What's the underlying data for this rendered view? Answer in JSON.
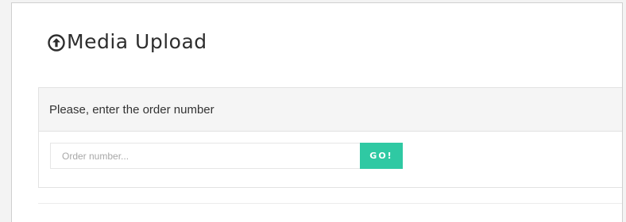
{
  "page": {
    "title": "Media Upload",
    "title_icon": "upload-circle-icon"
  },
  "order_panel": {
    "heading": "Please, enter the order number",
    "input_placeholder": "Order number...",
    "input_value": "",
    "submit_label": "GO!"
  },
  "colors": {
    "accent": "#2fc9a3",
    "panel_header_bg": "#f5f5f5",
    "title_text": "#2e2e2e"
  }
}
